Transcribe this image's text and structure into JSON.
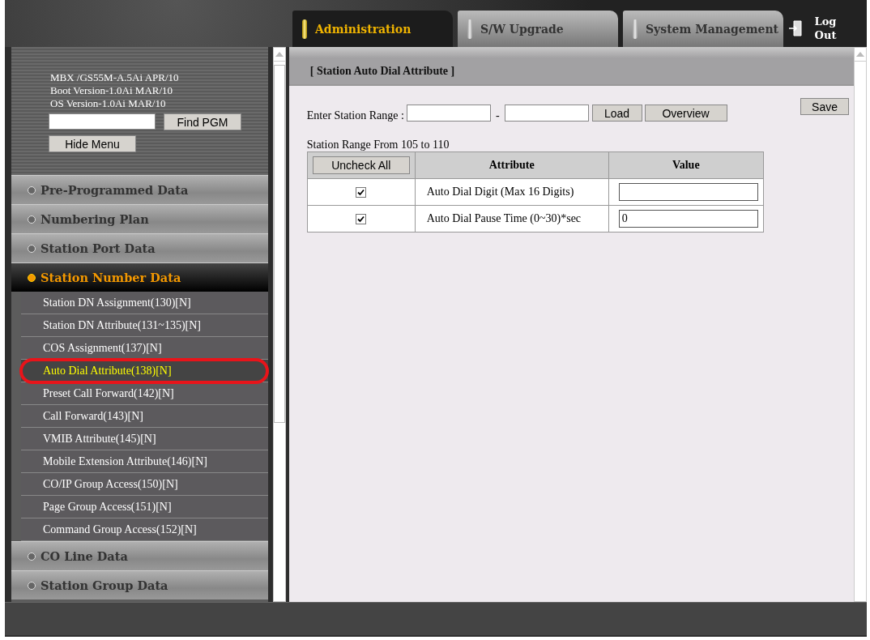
{
  "header": {
    "tabs": [
      {
        "label": "Administration",
        "selected": true
      },
      {
        "label": "S/W Upgrade",
        "selected": false
      },
      {
        "label": "System Management",
        "selected": false
      }
    ],
    "logout": "Log Out"
  },
  "system_info": [
    "MBX /GS55M-A.5Ai APR/10",
    "Boot Version-1.0Ai MAR/10",
    "OS Version-1.0Ai MAR/10"
  ],
  "find_button": "Find PGM",
  "hide_menu_button": "Hide Menu",
  "menu": [
    {
      "label": "Pre-Programmed Data",
      "expanded": false
    },
    {
      "label": "Numbering Plan",
      "expanded": false
    },
    {
      "label": "Station Port Data",
      "expanded": false
    },
    {
      "label": "Station Number Data",
      "expanded": true,
      "children": [
        {
          "label": "Station DN Assignment(130)[N]",
          "selected": false,
          "circled": false
        },
        {
          "label": "Station DN Attribute(131~135)[N]",
          "selected": false,
          "circled": false
        },
        {
          "label": "COS Assignment(137)[N]",
          "selected": false,
          "circled": false
        },
        {
          "label": "Auto Dial Attribute(138)[N]",
          "selected": true,
          "circled": true
        },
        {
          "label": "Preset Call Forward(142)[N]",
          "selected": false,
          "circled": false
        },
        {
          "label": "Call Forward(143)[N]",
          "selected": false,
          "circled": false
        },
        {
          "label": "VMIB Attribute(145)[N]",
          "selected": false,
          "circled": false
        },
        {
          "label": "Mobile Extension Attribute(146)[N]",
          "selected": false,
          "circled": false
        },
        {
          "label": "CO/IP Group Access(150)[N]",
          "selected": false,
          "circled": false
        },
        {
          "label": "Page Group Access(151)[N]",
          "selected": false,
          "circled": false
        },
        {
          "label": "Command Group Access(152)[N]",
          "selected": false,
          "circled": false
        }
      ]
    },
    {
      "label": "CO Line Data",
      "expanded": false
    },
    {
      "label": "Station Group Data",
      "expanded": false
    }
  ],
  "content": {
    "title": "[ Station Auto Dial Attribute ]",
    "range_label": "Enter Station Range :",
    "range_separator": "-",
    "load_button": "Load",
    "overview_button": "Overview",
    "save_button": "Save",
    "range_text": "Station Range From 105 to 110",
    "table": {
      "uncheck_all": "Uncheck All",
      "columns": [
        "Attribute",
        "Value"
      ],
      "rows": [
        {
          "checked": true,
          "attribute": "Auto Dial Digit (Max 16 Digits)"
        },
        {
          "checked": true,
          "attribute": "Auto Dial Pause Time (0~30)*sec",
          "value": "0"
        }
      ]
    }
  }
}
